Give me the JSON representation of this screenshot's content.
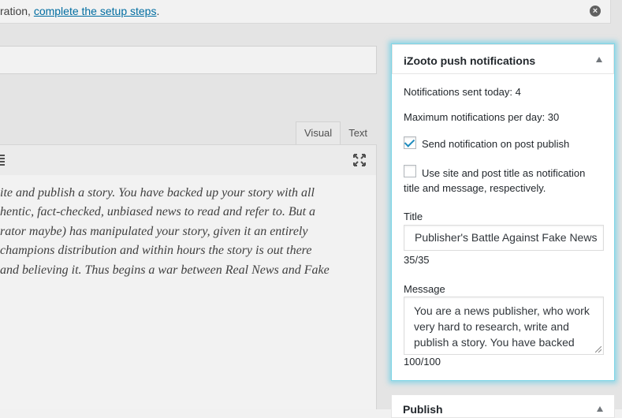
{
  "notice": {
    "prefix": "ration, ",
    "link": "complete the setup steps",
    "suffix": "."
  },
  "editor": {
    "tabs": [
      "Visual",
      "Text"
    ],
    "content_lines": [
      "ite and publish a story. You have backed up your story with all",
      "hentic, fact-checked, unbiased news to read and refer to. But a",
      "rator maybe) has manipulated your story, given it an entirely",
      "champions distribution and within hours the story is out there",
      "and believing it. Thus begins a war between Real News and Fake"
    ]
  },
  "metabox": {
    "title": "iZooto push notifications",
    "sent_today": "Notifications sent today: 4",
    "max_per_day": "Maximum notifications per day: 30",
    "send_on_publish": {
      "label": "Send notification on post publish",
      "checked": true
    },
    "use_site_title": {
      "label_line1": "Use site and post title as notification",
      "label_line2": "title and message, respectively.",
      "checked": false
    },
    "title_label": "Title",
    "title_value": "Publisher's Battle Against Fake News",
    "title_count": "35/35",
    "message_label": "Message",
    "message_value": "You are a news publisher, who work very hard to research, write and publish a story. You have backed",
    "message_count": "100/100"
  },
  "publish": {
    "title": "Publish"
  },
  "colors": {
    "accent": "#0073aa",
    "highlight": "#7fd5e6"
  }
}
